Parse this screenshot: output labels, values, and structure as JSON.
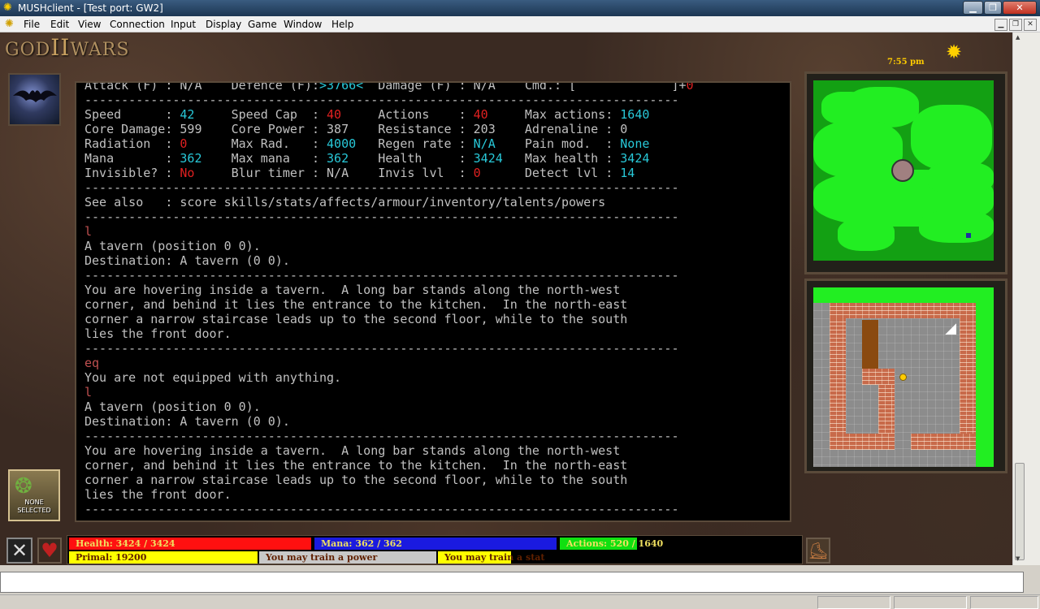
{
  "window": {
    "title": "MUSHclient - [Test port: GW2]",
    "app_icon": "mushclient-icon"
  },
  "menu": [
    "File",
    "Edit",
    "View",
    "Connection",
    "Input",
    "Display",
    "Game",
    "Window",
    "Help"
  ],
  "hud": {
    "logo_left": "GOD",
    "logo_mid": "II",
    "logo_right": "WARS",
    "clock": "7:55 pm",
    "target_label": "NONE SELECTED"
  },
  "terminal": [
    [
      [
        "wh",
        "Attack (F) : N/A    Defence (F):"
      ],
      [
        "cy",
        ">3766<"
      ],
      [
        "wh",
        "  Damage (F) : N/A    Cmd.: [             ]+"
      ],
      [
        "rd",
        "0"
      ]
    ],
    [
      [
        "wh",
        "---------------------------------------------------------------------------------"
      ]
    ],
    [
      [
        "wh",
        "Speed      : "
      ],
      [
        "cy",
        "42"
      ],
      [
        "wh",
        "     Speed Cap  : "
      ],
      [
        "rd",
        "40"
      ],
      [
        "wh",
        "     Actions    : "
      ],
      [
        "rd",
        "40"
      ],
      [
        "wh",
        "     Max actions: "
      ],
      [
        "cy",
        "1640"
      ]
    ],
    [
      [
        "wh",
        "Core Damage: 599    Core Power : 387    Resistance : 203    Adrenaline : 0"
      ]
    ],
    [
      [
        "wh",
        "Radiation  : "
      ],
      [
        "rd",
        "0"
      ],
      [
        "wh",
        "      Max Rad.   : "
      ],
      [
        "cy",
        "4000"
      ],
      [
        "wh",
        "   Regen rate : "
      ],
      [
        "cy",
        "N/A"
      ],
      [
        "wh",
        "    Pain mod.  : "
      ],
      [
        "cy",
        "None"
      ]
    ],
    [
      [
        "wh",
        "Mana       : "
      ],
      [
        "cy",
        "362"
      ],
      [
        "wh",
        "    Max mana   : "
      ],
      [
        "cy",
        "362"
      ],
      [
        "wh",
        "    Health     : "
      ],
      [
        "cy",
        "3424"
      ],
      [
        "wh",
        "   Max health : "
      ],
      [
        "cy",
        "3424"
      ]
    ],
    [
      [
        "wh",
        "Invisible? : "
      ],
      [
        "rd",
        "No"
      ],
      [
        "wh",
        "     Blur timer : N/A    Invis lvl  : "
      ],
      [
        "rd",
        "0"
      ],
      [
        "wh",
        "      Detect lvl : "
      ],
      [
        "cy",
        "14"
      ]
    ],
    [
      [
        "wh",
        "---------------------------------------------------------------------------------"
      ]
    ],
    [
      [
        "wh",
        "See also   : score skills/stats/affects/armour/inventory/talents/powers"
      ]
    ],
    [
      [
        "wh",
        "---------------------------------------------------------------------------------"
      ]
    ],
    [
      [
        "dk",
        "l"
      ]
    ],
    [
      [
        "wh",
        "A tavern (position 0 0)."
      ]
    ],
    [
      [
        "wh",
        "Destination: A tavern (0 0)."
      ]
    ],
    [
      [
        "wh",
        "---------------------------------------------------------------------------------"
      ]
    ],
    [
      [
        "wh",
        "You are hovering inside a tavern.  A long bar stands along the north-west"
      ]
    ],
    [
      [
        "wh",
        "corner, and behind it lies the entrance to the kitchen.  In the north-east"
      ]
    ],
    [
      [
        "wh",
        "corner a narrow staircase leads up to the second floor, while to the south"
      ]
    ],
    [
      [
        "wh",
        "lies the front door."
      ]
    ],
    [
      [
        "wh",
        "---------------------------------------------------------------------------------"
      ]
    ],
    [
      [
        "dk",
        "eq"
      ]
    ],
    [
      [
        "wh",
        "You are not equipped with anything."
      ]
    ],
    [
      [
        "dk",
        "l"
      ]
    ],
    [
      [
        "wh",
        "A tavern (position 0 0)."
      ]
    ],
    [
      [
        "wh",
        "Destination: A tavern (0 0)."
      ]
    ],
    [
      [
        "wh",
        "---------------------------------------------------------------------------------"
      ]
    ],
    [
      [
        "wh",
        "You are hovering inside a tavern.  A long bar stands along the north-west"
      ]
    ],
    [
      [
        "wh",
        "corner, and behind it lies the entrance to the kitchen.  In the north-east"
      ]
    ],
    [
      [
        "wh",
        "corner a narrow staircase leads up to the second floor, while to the south"
      ]
    ],
    [
      [
        "wh",
        "lies the front door."
      ]
    ],
    [
      [
        "wh",
        "---------------------------------------------------------------------------------"
      ]
    ]
  ],
  "bars": {
    "health": {
      "label": "Health: 3424 / 3424",
      "fraction": 1.0
    },
    "mana": {
      "label": "Mana: 362 / 362",
      "fraction": 1.0
    },
    "actions": {
      "label": "Actions: 520 / 1640",
      "fraction": 0.32
    },
    "primal": "Primal: 19200",
    "power": "You may train a power",
    "stat": "You may train a stat"
  },
  "colors": {
    "health": "#ff1010",
    "mana": "#1a1ae0",
    "actions": "#10e010",
    "primal": "#ffff00"
  }
}
